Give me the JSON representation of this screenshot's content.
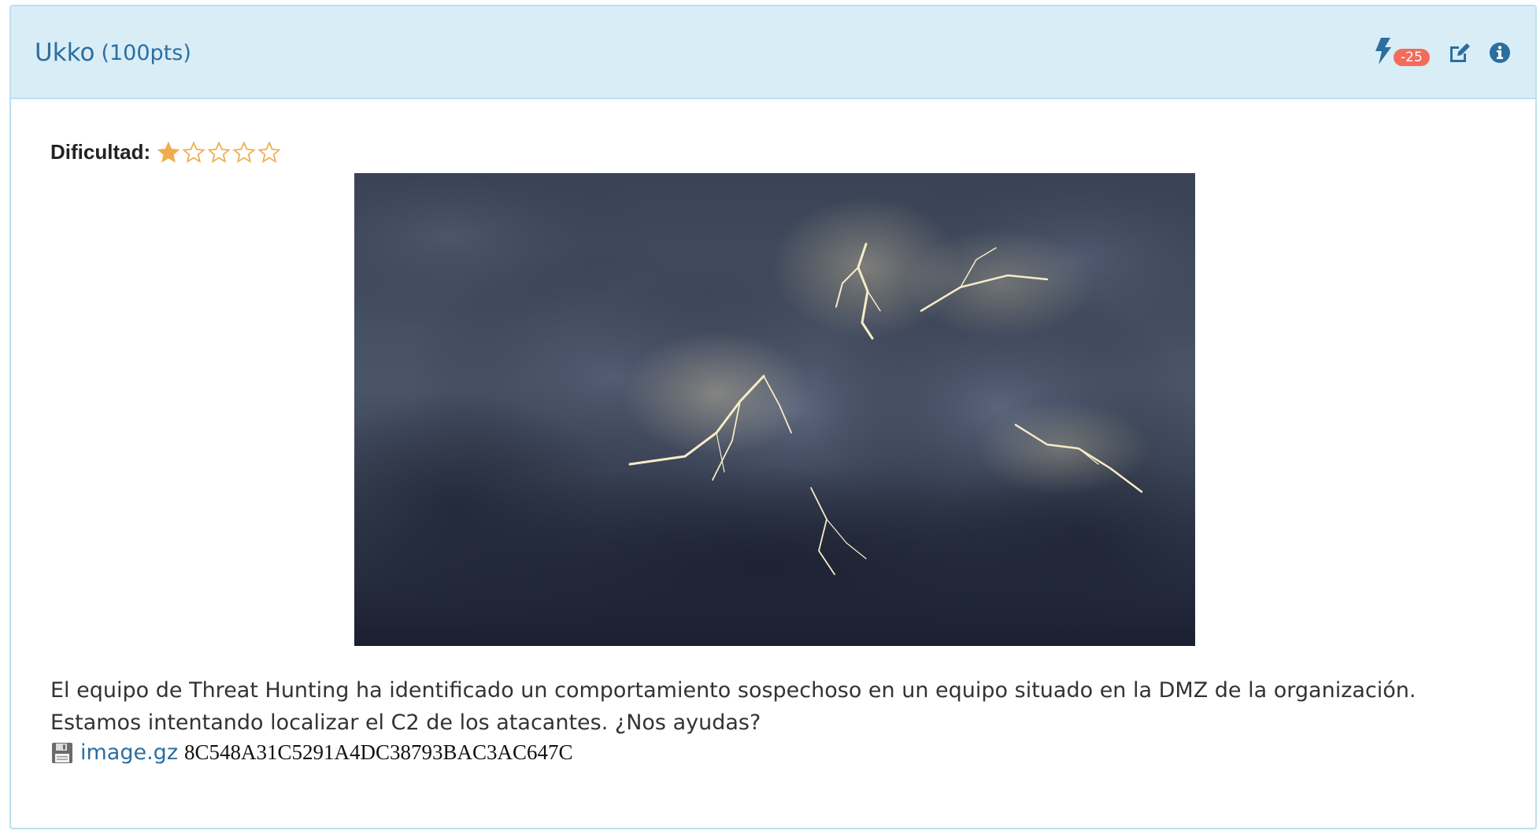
{
  "challenge": {
    "name": "Ukko",
    "points": "(100pts)",
    "penalty_badge": "-25"
  },
  "difficulty": {
    "label": "Dificultad:",
    "rating": 1,
    "max": 5,
    "star_color": "#f0ad4e"
  },
  "image": {
    "alt": "stormy-clouds-with-lightning"
  },
  "description": {
    "line1": "El equipo de Threat Hunting ha identificado un comportamiento sospechoso en un equipo situado en la DMZ de la organización.",
    "line2": "Estamos intentando localizar el C2 de los atacantes. ¿Nos ayudas?"
  },
  "file": {
    "name": "image.gz",
    "hash": "8C548A31C5291A4DC38793BAC3AC647C",
    "icon": "floppy-disk-icon"
  },
  "colors": {
    "header_bg": "#d9edf7",
    "border": "#bcdff1",
    "link": "#2b6ea0",
    "badge": "#f26b5b"
  }
}
